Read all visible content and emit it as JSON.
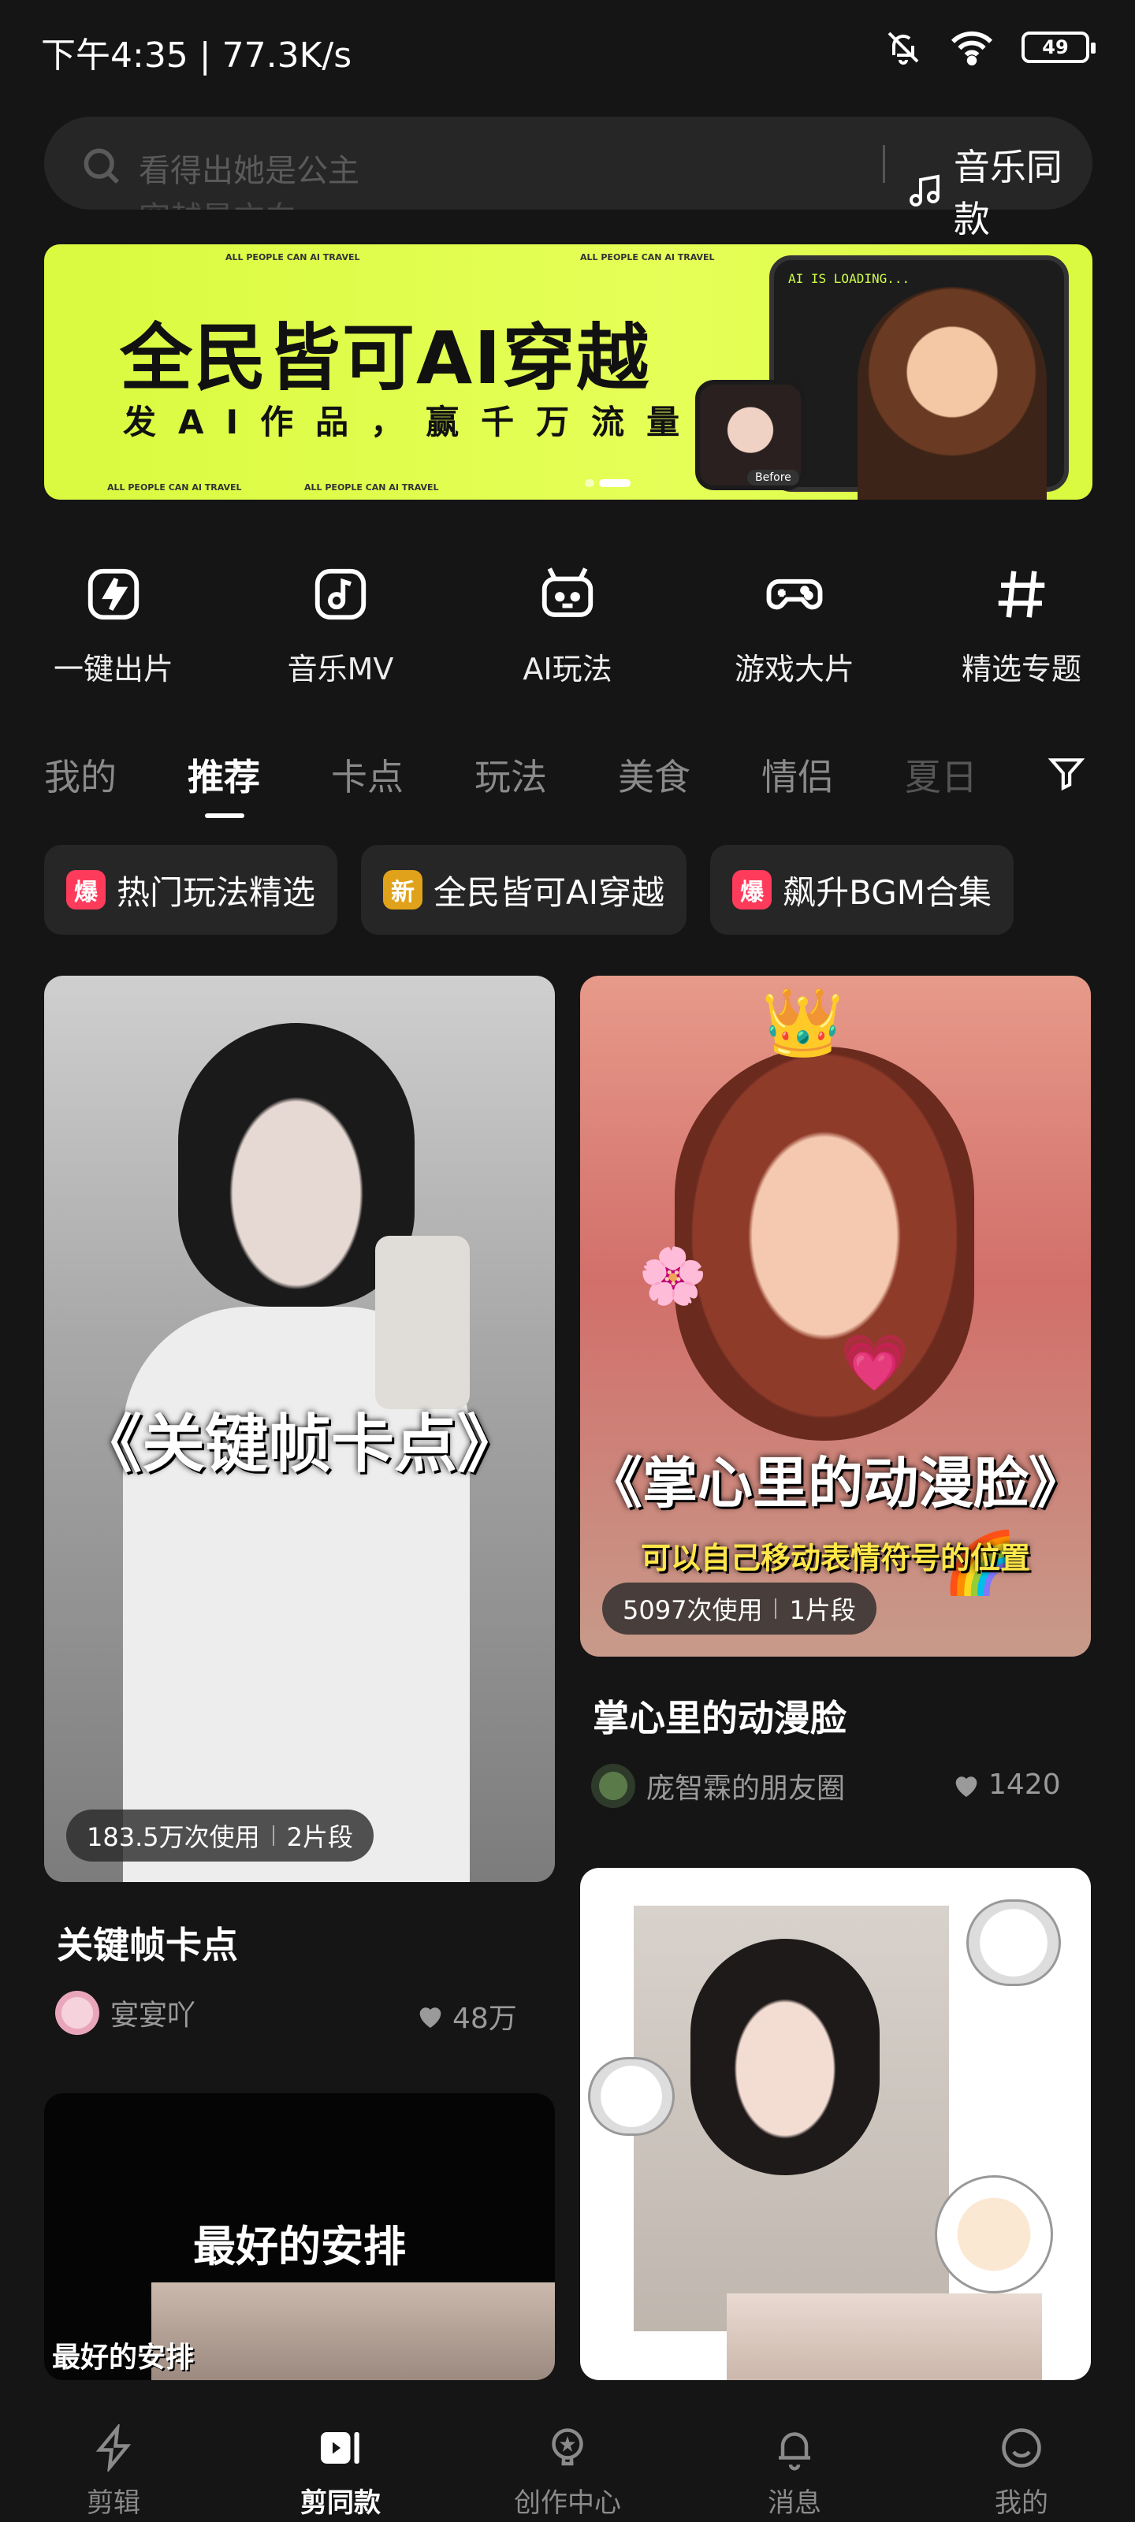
{
  "status_bar": {
    "time": "下午4:35 | 77.3K/s",
    "battery": "49"
  },
  "search": {
    "placeholder": "看得出她是公主",
    "placeholder_next": "穿越是方向",
    "music_label": "音乐同款"
  },
  "banner": {
    "title": "全民皆可AI穿越",
    "subtitle": "发AI作品，赢千万流量",
    "small_text": "ALL PEOPLE CAN AI TRAVEL",
    "loading_text": "AI IS LOADING...",
    "before_label": "Before"
  },
  "quick": [
    {
      "label": "一键出片",
      "icon": "lightning-icon"
    },
    {
      "label": "音乐MV",
      "icon": "music-note-icon"
    },
    {
      "label": "AI玩法",
      "icon": "robot-icon"
    },
    {
      "label": "游戏大片",
      "icon": "gamepad-icon"
    },
    {
      "label": "精选专题",
      "icon": "hashtag-icon"
    }
  ],
  "tabs": [
    "我的",
    "推荐",
    "卡点",
    "玩法",
    "美食",
    "情侣",
    "夏日"
  ],
  "chips": [
    {
      "badge": "爆",
      "label": "热门玩法精选",
      "color": "#ff3b5c"
    },
    {
      "badge": "新",
      "label": "全民皆可AI穿越",
      "color": "#e0a21a"
    },
    {
      "badge": "爆",
      "label": "飙升BGM合集",
      "color": "#ff3b5c"
    }
  ],
  "cards": {
    "left1": {
      "overlay": "《关键帧卡点》",
      "uses": "183.5万次使用",
      "segments": "2片段",
      "title": "关键帧卡点",
      "author": "宴宴吖",
      "likes": "48万"
    },
    "right1": {
      "overlay": "《掌心里的动漫脸》",
      "overlay_sub": "可以自己移动表情符号的位置",
      "uses": "5097次使用",
      "segments": "1片段",
      "title": "掌心里的动漫脸",
      "author": "庞智霖的朋友圈",
      "likes": "1420"
    },
    "left2": {
      "overlay": "最好的安排",
      "overlay_small": "最好的安排"
    }
  },
  "nav": [
    {
      "label": "剪辑",
      "icon": "lightning-icon"
    },
    {
      "label": "剪同款",
      "icon": "play-icon"
    },
    {
      "label": "创作中心",
      "icon": "lightbulb-icon"
    },
    {
      "label": "消息",
      "icon": "bell-icon"
    },
    {
      "label": "我的",
      "icon": "smile-icon"
    }
  ]
}
